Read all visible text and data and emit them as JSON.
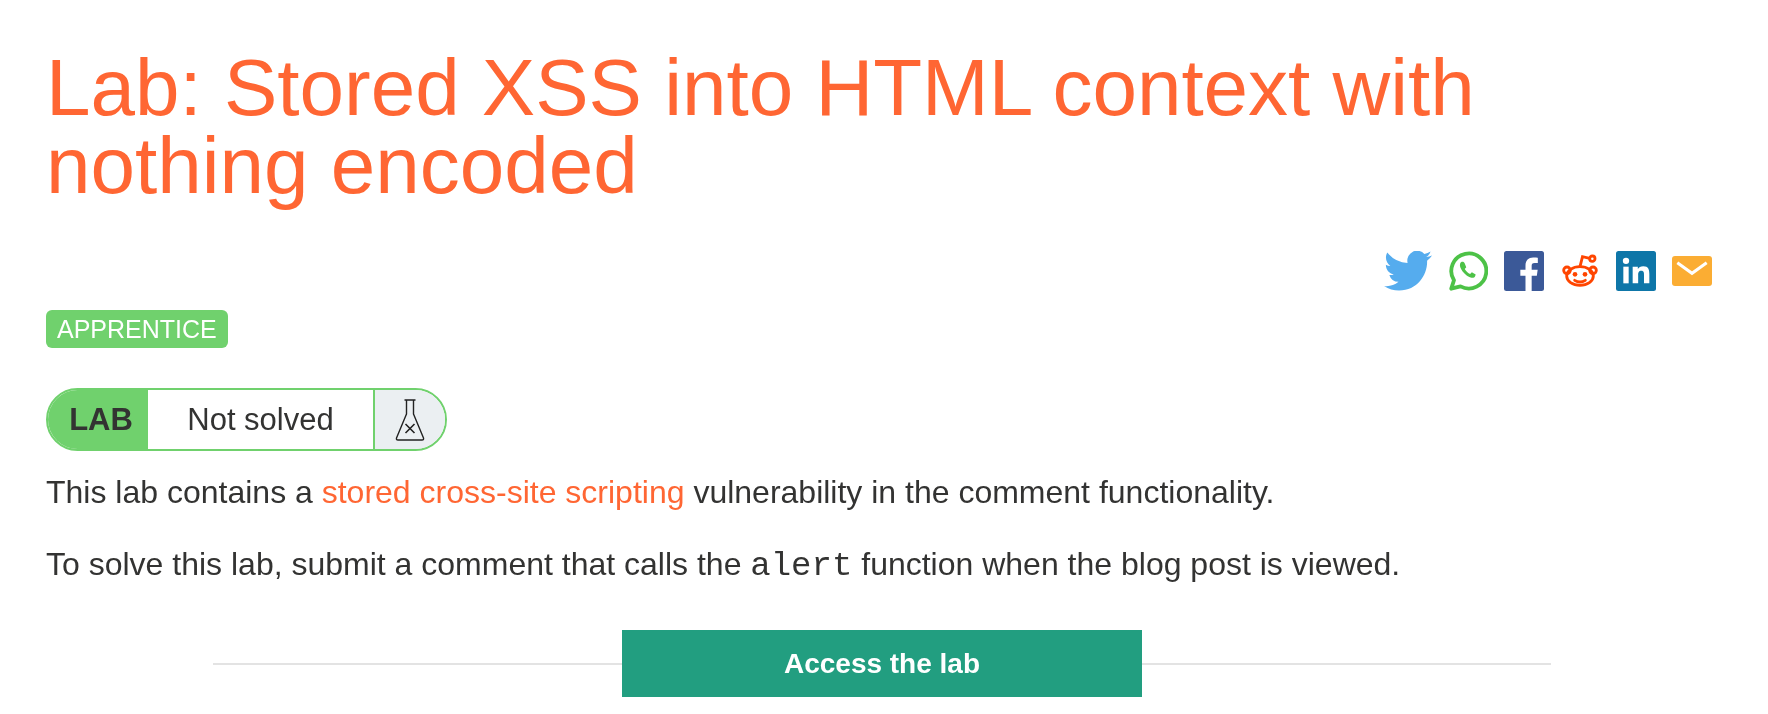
{
  "title": "Lab: Stored XSS into HTML context with nothing encoded",
  "level_badge": "APPRENTICE",
  "lab_status": {
    "label": "LAB",
    "status": "Not solved",
    "solved": false
  },
  "paragraphs": [
    {
      "parts": [
        {
          "kind": "text",
          "text": "This lab contains a "
        },
        {
          "kind": "link",
          "text": "stored cross-site scripting"
        },
        {
          "kind": "text",
          "text": " vulnerability in the comment functionality."
        }
      ]
    },
    {
      "parts": [
        {
          "kind": "text",
          "text": "To solve this lab, submit a comment that calls the "
        },
        {
          "kind": "code",
          "text": "alert"
        },
        {
          "kind": "text",
          "text": " function when the blog post is viewed."
        }
      ]
    }
  ],
  "access_button": "Access the lab"
}
